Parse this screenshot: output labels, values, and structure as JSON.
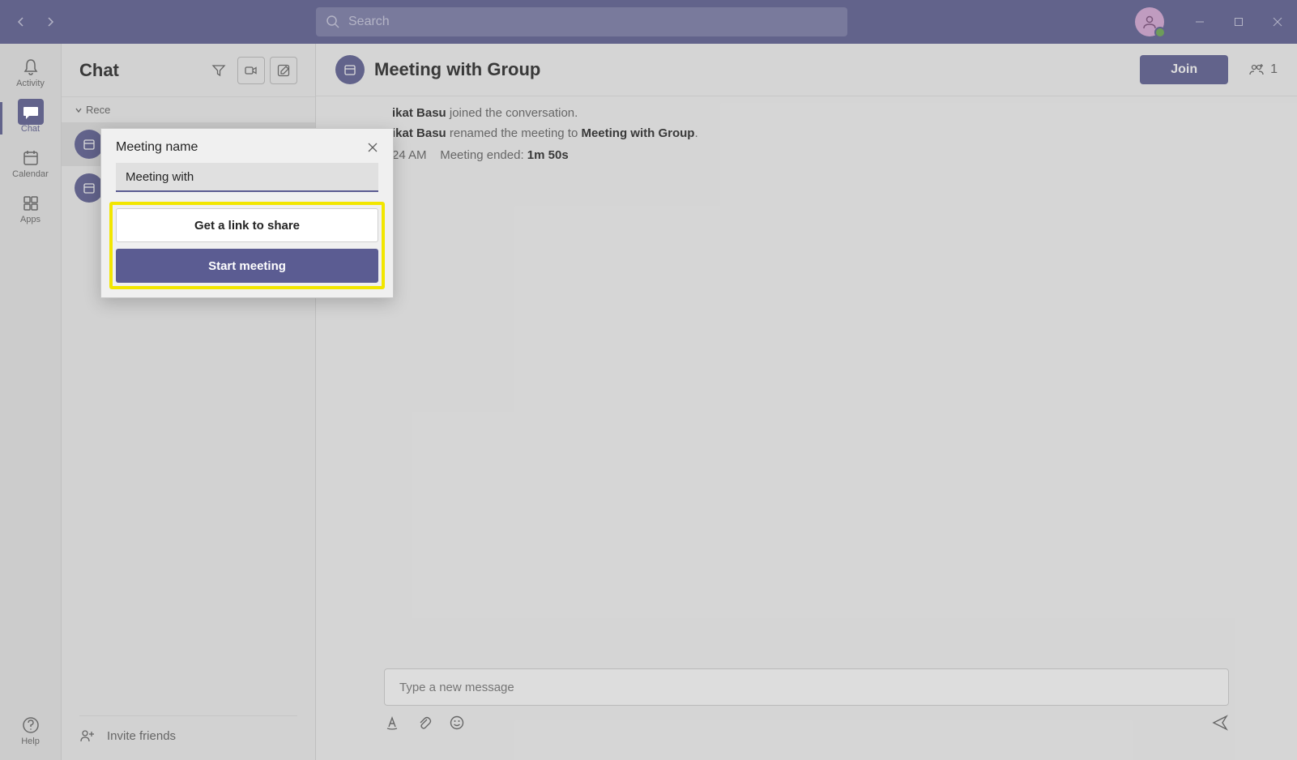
{
  "titlebar": {
    "search_placeholder": "Search"
  },
  "rail": {
    "items": [
      {
        "label": "Activity"
      },
      {
        "label": "Chat"
      },
      {
        "label": "Calendar"
      },
      {
        "label": "Apps"
      }
    ],
    "help_label": "Help"
  },
  "chat_panel": {
    "title": "Chat",
    "recent_label": "Rece",
    "invite_label": "Invite friends"
  },
  "main": {
    "title": "Meeting with Group",
    "join_label": "Join",
    "participant_count": "1",
    "conversation": {
      "line1_name": "ikat Basu",
      "line1_rest": " joined the conversation.",
      "line2_name": "ikat Basu",
      "line2_mid": " renamed the meeting to ",
      "line2_newname": "Meeting with Group",
      "line2_end": ".",
      "line3_time": "24 AM",
      "line3_ended_label": "Meeting ended: ",
      "line3_duration": "1m 50s"
    },
    "compose_placeholder": "Type a new message"
  },
  "popover": {
    "title": "Meeting name",
    "input_value": "Meeting with",
    "get_link_label": "Get a link to share",
    "start_label": "Start meeting"
  }
}
